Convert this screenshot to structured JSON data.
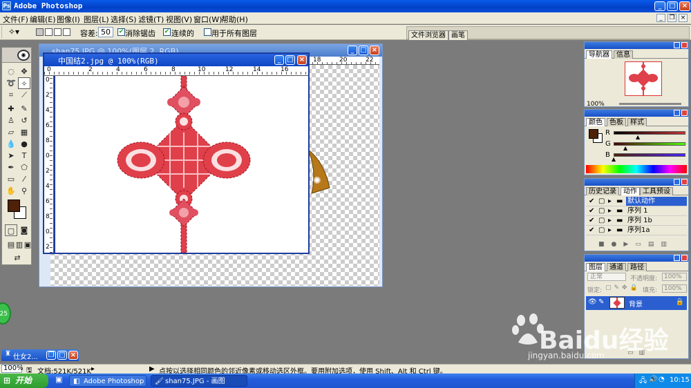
{
  "app": {
    "title": "Adobe Photoshop"
  },
  "menu": {
    "items": [
      "文件(F)",
      "编辑(E)",
      "图像(I)",
      "图层(L)",
      "选择(S)",
      "滤镜(T)",
      "视图(V)",
      "窗口(W)",
      "帮助(H)"
    ]
  },
  "options": {
    "tolerance_label": "容差:",
    "tolerance_value": "50",
    "antialias_label": "消除锯齿",
    "antialias_checked": true,
    "contiguous_label": "连续的",
    "contiguous_checked": true,
    "sample_all_label": "用于所有图层",
    "sample_all_checked": false,
    "well_tabs": [
      "文件浏览器",
      "画笔"
    ]
  },
  "documents": {
    "back_title": "shan75.JPG @ 100%(图层 2, RGB)",
    "front_title": "中国结2.jpg @ 100%(RGB)",
    "front_ruler_h": [
      "0",
      "2",
      "4",
      "6",
      "8",
      "10",
      "12",
      "14",
      "16"
    ],
    "front_ruler_v": [
      "0",
      "2",
      "4",
      "6",
      "8",
      "0",
      "2",
      "4",
      "6",
      "8",
      "0",
      "2"
    ],
    "back_ruler_h": [
      "18",
      "20",
      "22"
    ],
    "minimized_title": "仕女2...",
    "green_badge": "25"
  },
  "navigator": {
    "tabs": [
      "导航器",
      "信息"
    ],
    "zoom": "100%"
  },
  "color_panel": {
    "tabs": [
      "颜色",
      "色板",
      "样式"
    ],
    "channels": [
      {
        "label": "R",
        "value": "78",
        "color": "#c83232",
        "pos": 0.31
      },
      {
        "label": "G",
        "value": "33",
        "color": "#2c9a2c",
        "pos": 0.13
      },
      {
        "label": "B",
        "value": "0",
        "color": "#2c2cc8",
        "pos": 0.0
      }
    ],
    "foreground": "#4e2108"
  },
  "actions_panel": {
    "tabs": [
      "历史记录",
      "动作",
      "工具预设"
    ],
    "rows": [
      "默认动作",
      "序列 1",
      "序列 1b",
      "序列1a"
    ]
  },
  "layers_panel": {
    "tabs": [
      "图层",
      "通道",
      "路径"
    ],
    "blend_mode": "正常",
    "opacity_label": "不透明度:",
    "opacity_value": "100%",
    "lock_label": "锁定:",
    "fill_label": "填充:",
    "fill_value": "100%",
    "layer_name": "背景"
  },
  "status": {
    "zoom": "100%",
    "doc_size": "文档:521K/521K",
    "hint": "点按以选择相同颜色的邻近像素或移动选区外框。要用附加选项，使用 Shift、Alt 和 Ctrl 键。"
  },
  "taskbar": {
    "start": "开始",
    "tasks": [
      "Adobe Photoshop",
      "shan75.JPG - 画图"
    ],
    "clock": "10:15"
  },
  "watermark": {
    "text": "Baidu经验",
    "url": "jingyan.baidu.com"
  },
  "colors": {
    "knot_red": "#e0404a",
    "titlebar_blue": "#0a4fd8",
    "app_bg": "#7b7b7b"
  }
}
